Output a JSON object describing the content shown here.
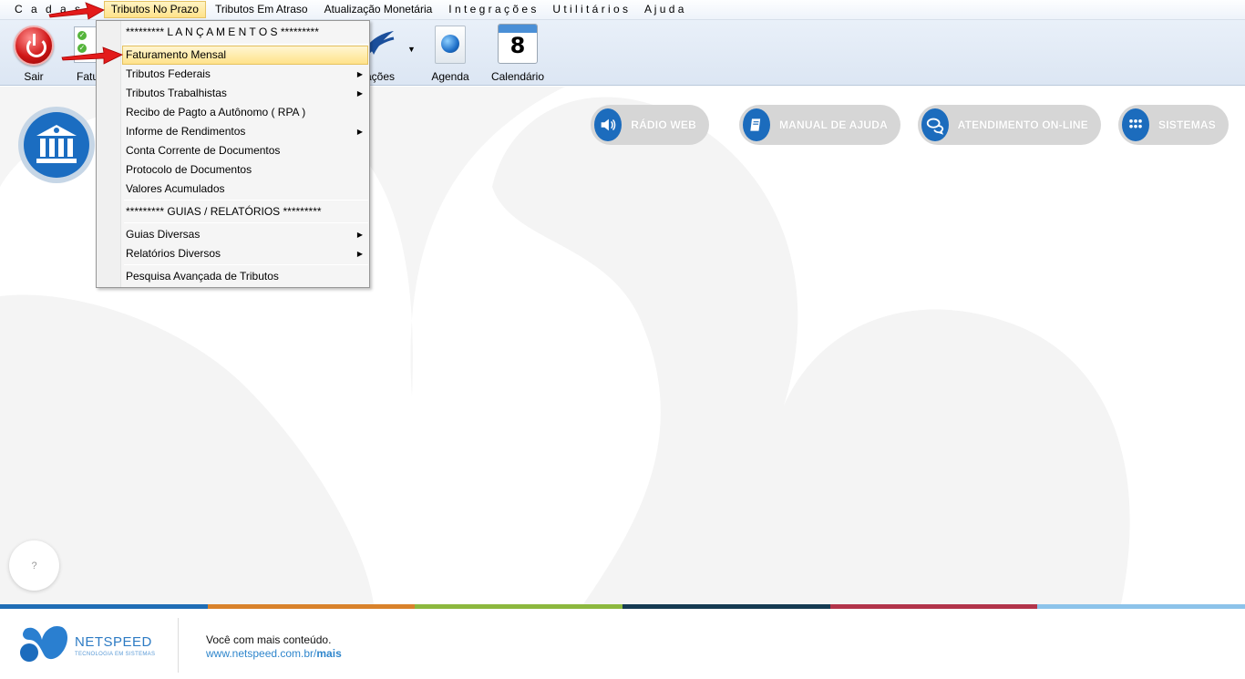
{
  "menubar": {
    "items": [
      {
        "label": "Cadastros",
        "shown": "C a d a s t",
        "spaced": true
      },
      {
        "label": "Tributos No Prazo",
        "active": true
      },
      {
        "label": "Tributos Em Atraso"
      },
      {
        "label": "Atualização Monetária"
      },
      {
        "label": "Integrações",
        "shown": "I n t e g r a ç õ e s"
      },
      {
        "label": "Utilitários",
        "shown": "U t i l i t á r i o s"
      },
      {
        "label": "Ajuda",
        "shown": "A j u d a"
      }
    ]
  },
  "toolbar": {
    "sair_label": "Sair",
    "fatu_label": "Fatu",
    "integ_label": "rações",
    "agenda_label": "Agenda",
    "calendar_label": "Calendário",
    "calendar_day": "8"
  },
  "dropdown": {
    "items": [
      {
        "label": "********* L A N Ç A M E N T O S *********",
        "submenu": false
      },
      {
        "label": "Faturamento Mensal",
        "submenu": false,
        "highlighted": true
      },
      {
        "label": "Tributos Federais",
        "submenu": true
      },
      {
        "label": "Tributos Trabalhistas",
        "submenu": true
      },
      {
        "label": "Recibo de Pagto a Autônomo ( RPA )",
        "submenu": false
      },
      {
        "label": "Informe de Rendimentos",
        "submenu": true
      },
      {
        "label": "Conta Corrente de Documentos",
        "submenu": false
      },
      {
        "label": "Protocolo de Documentos",
        "submenu": false
      },
      {
        "label": "Valores Acumulados",
        "submenu": false
      },
      {
        "label": "********* GUIAS / RELATÓRIOS *********",
        "submenu": false
      },
      {
        "label": "Guias Diversas",
        "submenu": true
      },
      {
        "label": "Relatórios Diversos",
        "submenu": true
      },
      {
        "label": "Pesquisa Avançada de Tributos",
        "submenu": false
      }
    ]
  },
  "quick_links": {
    "radio": "RÁDIO WEB",
    "manual": "MANUAL DE AJUDA",
    "atendimento": "ATENDIMENTO ON-LINE",
    "sistemas": "SISTEMAS"
  },
  "help": "?",
  "footer": {
    "brand": "NETSPEED",
    "brand_sub": "TECNOLOGIA EM SISTEMAS",
    "tagline": "Você com mais conteúdo.",
    "url_base": "www.netspeed.com.br/",
    "url_bold": "mais"
  },
  "colors": {
    "accent": "#1c6cbd",
    "highlight": "#ffe28a",
    "band": [
      "#1f6db5",
      "#d9822b",
      "#8cb83e",
      "#153a52",
      "#b2344a",
      "#8cc3ea"
    ]
  }
}
